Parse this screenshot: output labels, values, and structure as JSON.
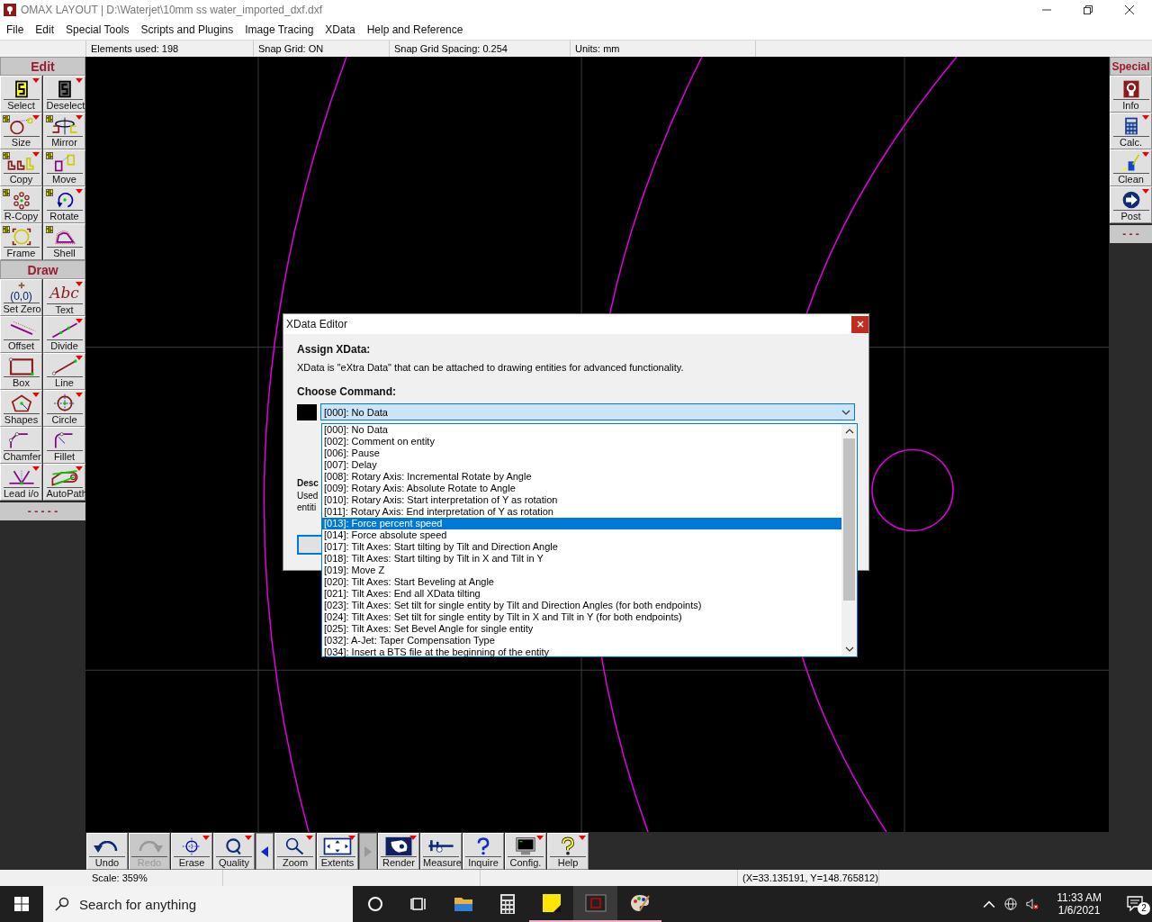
{
  "window": {
    "title": "OMAX LAYOUT | D:\\Waterjet\\10mm ss water_imported_dxf.dxf"
  },
  "menu": [
    "File",
    "Edit",
    "Special Tools",
    "Scripts and Plugins",
    "Image Tracing",
    "XData",
    "Help and Reference"
  ],
  "info_bar": [
    "Elements used: 198",
    "Snap Grid: ON",
    "Snap Grid Spacing: 0.254",
    "Units: mm"
  ],
  "left_toolbar": {
    "sections": [
      {
        "title": "Edit",
        "tools": [
          {
            "label": "Select",
            "menu": true,
            "selection_badge": false
          },
          {
            "label": "Deselect",
            "menu": true,
            "selection_badge": false
          },
          {
            "label": "Size",
            "menu": true,
            "selection_badge": true
          },
          {
            "label": "Mirror",
            "menu": true,
            "selection_badge": true
          },
          {
            "label": "Copy",
            "menu": true,
            "selection_badge": true
          },
          {
            "label": "Move",
            "menu": false,
            "selection_badge": true
          },
          {
            "label": "R-Copy",
            "menu": false,
            "selection_badge": true
          },
          {
            "label": "Rotate",
            "menu": true,
            "selection_badge": true
          },
          {
            "label": "Frame",
            "menu": false,
            "selection_badge": true
          },
          {
            "label": "Shell",
            "menu": false,
            "selection_badge": true
          }
        ]
      },
      {
        "title": "Draw",
        "tools": [
          {
            "label": "Set Zero",
            "menu": false,
            "selection_badge": false,
            "icon_text": "(0,0)"
          },
          {
            "label": "Text",
            "menu": true,
            "selection_badge": false,
            "icon_text": "Abc"
          },
          {
            "label": "Offset",
            "menu": false,
            "selection_badge": false
          },
          {
            "label": "Divide",
            "menu": true,
            "selection_badge": false
          },
          {
            "label": "Box",
            "menu": false,
            "selection_badge": false
          },
          {
            "label": "Line",
            "menu": true,
            "selection_badge": false
          },
          {
            "label": "Shapes",
            "menu": true,
            "selection_badge": false
          },
          {
            "label": "Circle",
            "menu": true,
            "selection_badge": false
          },
          {
            "label": "Chamfer",
            "menu": false,
            "selection_badge": false
          },
          {
            "label": "Fillet",
            "menu": false,
            "selection_badge": false
          },
          {
            "label": "Lead i/o",
            "menu": true,
            "selection_badge": false
          },
          {
            "label": "AutoPath",
            "menu": true,
            "selection_badge": false
          }
        ]
      }
    ],
    "footer": "- - - - -"
  },
  "right_toolbar": {
    "title": "Special",
    "tools": [
      {
        "label": "Info",
        "menu": false
      },
      {
        "label": "Calc.",
        "menu": true
      },
      {
        "label": "Clean",
        "menu": true
      },
      {
        "label": "Post",
        "menu": true
      }
    ],
    "footer": "- - -"
  },
  "bottom_toolbar": [
    {
      "kind": "tool",
      "label": "Undo",
      "menu": false,
      "disabled": false
    },
    {
      "kind": "tool",
      "label": "Redo",
      "menu": false,
      "disabled": true
    },
    {
      "kind": "tool",
      "label": "Erase",
      "menu": true,
      "disabled": false
    },
    {
      "kind": "tool",
      "label": "Quality",
      "menu": true,
      "disabled": false
    },
    {
      "kind": "arrow",
      "disabled": false
    },
    {
      "kind": "tool",
      "label": "Zoom",
      "menu": true,
      "disabled": false
    },
    {
      "kind": "tool",
      "label": "Extents",
      "menu": true,
      "disabled": false
    },
    {
      "kind": "arrow",
      "disabled": true
    },
    {
      "kind": "tool",
      "label": "Render",
      "menu": true,
      "disabled": false
    },
    {
      "kind": "tool",
      "label": "Measure",
      "menu": false,
      "disabled": false
    },
    {
      "kind": "tool",
      "label": "Inquire",
      "menu": false,
      "disabled": false
    },
    {
      "kind": "tool",
      "label": "Config.",
      "menu": true,
      "disabled": false
    },
    {
      "kind": "tool",
      "label": "Help",
      "menu": true,
      "disabled": false
    }
  ],
  "status_bar": {
    "scale": "Scale: 359%",
    "coordinates": "(X=33.135191, Y=148.765812)"
  },
  "dialog": {
    "title": "XData Editor",
    "heading": "Assign XData:",
    "intro": "XData is \"eXtra Data\" that can be attached to drawing entities for advanced functionality.",
    "command_label": "Choose Command:",
    "command_value": "[000]: No Data",
    "description_label": "Desc",
    "description_lines": [
      "Used",
      "entiti"
    ],
    "options": [
      {
        "label": "[000]: No Data",
        "selected": false
      },
      {
        "label": "[002]: Comment on entity",
        "selected": false
      },
      {
        "label": "[006]: Pause",
        "selected": false
      },
      {
        "label": "[007]: Delay",
        "selected": false
      },
      {
        "label": "[008]: Rotary Axis: Incremental Rotate by Angle",
        "selected": false
      },
      {
        "label": "[009]: Rotary Axis: Absolute Rotate to Angle",
        "selected": false
      },
      {
        "label": "[010]: Rotary Axis: Start interpretation of Y as rotation",
        "selected": false
      },
      {
        "label": "[011]: Rotary Axis: End interpretation of Y as rotation",
        "selected": false
      },
      {
        "label": "[013]: Force percent speed",
        "selected": true
      },
      {
        "label": "[014]: Force absolute speed",
        "selected": false
      },
      {
        "label": "[017]: Tilt Axes: Start tilting by Tilt and Direction Angle",
        "selected": false
      },
      {
        "label": "[018]: Tilt Axes: Start tilting by Tilt in X and Tilt in Y",
        "selected": false
      },
      {
        "label": "[019]: Move Z",
        "selected": false
      },
      {
        "label": "[020]: Tilt Axes: Start Beveling at Angle",
        "selected": false
      },
      {
        "label": "[021]: Tilt Axes: End all XData tilting",
        "selected": false
      },
      {
        "label": "[023]: Tilt Axes: Set tilt for single entity by Tilt and Direction Angles (for both endpoints)",
        "selected": false
      },
      {
        "label": "[024]: Tilt Axes: Set tilt for single entity by Tilt in X and Tilt in Y (for both endpoints)",
        "selected": false
      },
      {
        "label": "[025]: Tilt Axes: Set Bevel Angle for single entity",
        "selected": false
      },
      {
        "label": "[032]: A-Jet: Taper Compensation Type",
        "selected": false
      },
      {
        "label": "[034]: Insert a BTS file at the beginning of the entity",
        "selected": false
      }
    ]
  },
  "taskbar": {
    "search_placeholder": "Search for anything",
    "apps": [
      {
        "open": false,
        "active": false
      },
      {
        "open": false,
        "active": false
      },
      {
        "open": false,
        "active": false
      },
      {
        "open": false,
        "active": false
      },
      {
        "open": true,
        "active": false
      },
      {
        "open": true,
        "active": true
      },
      {
        "open": true,
        "active": false
      }
    ],
    "time": "11:33 AM",
    "date": "1/6/2021",
    "notifications": "2"
  }
}
